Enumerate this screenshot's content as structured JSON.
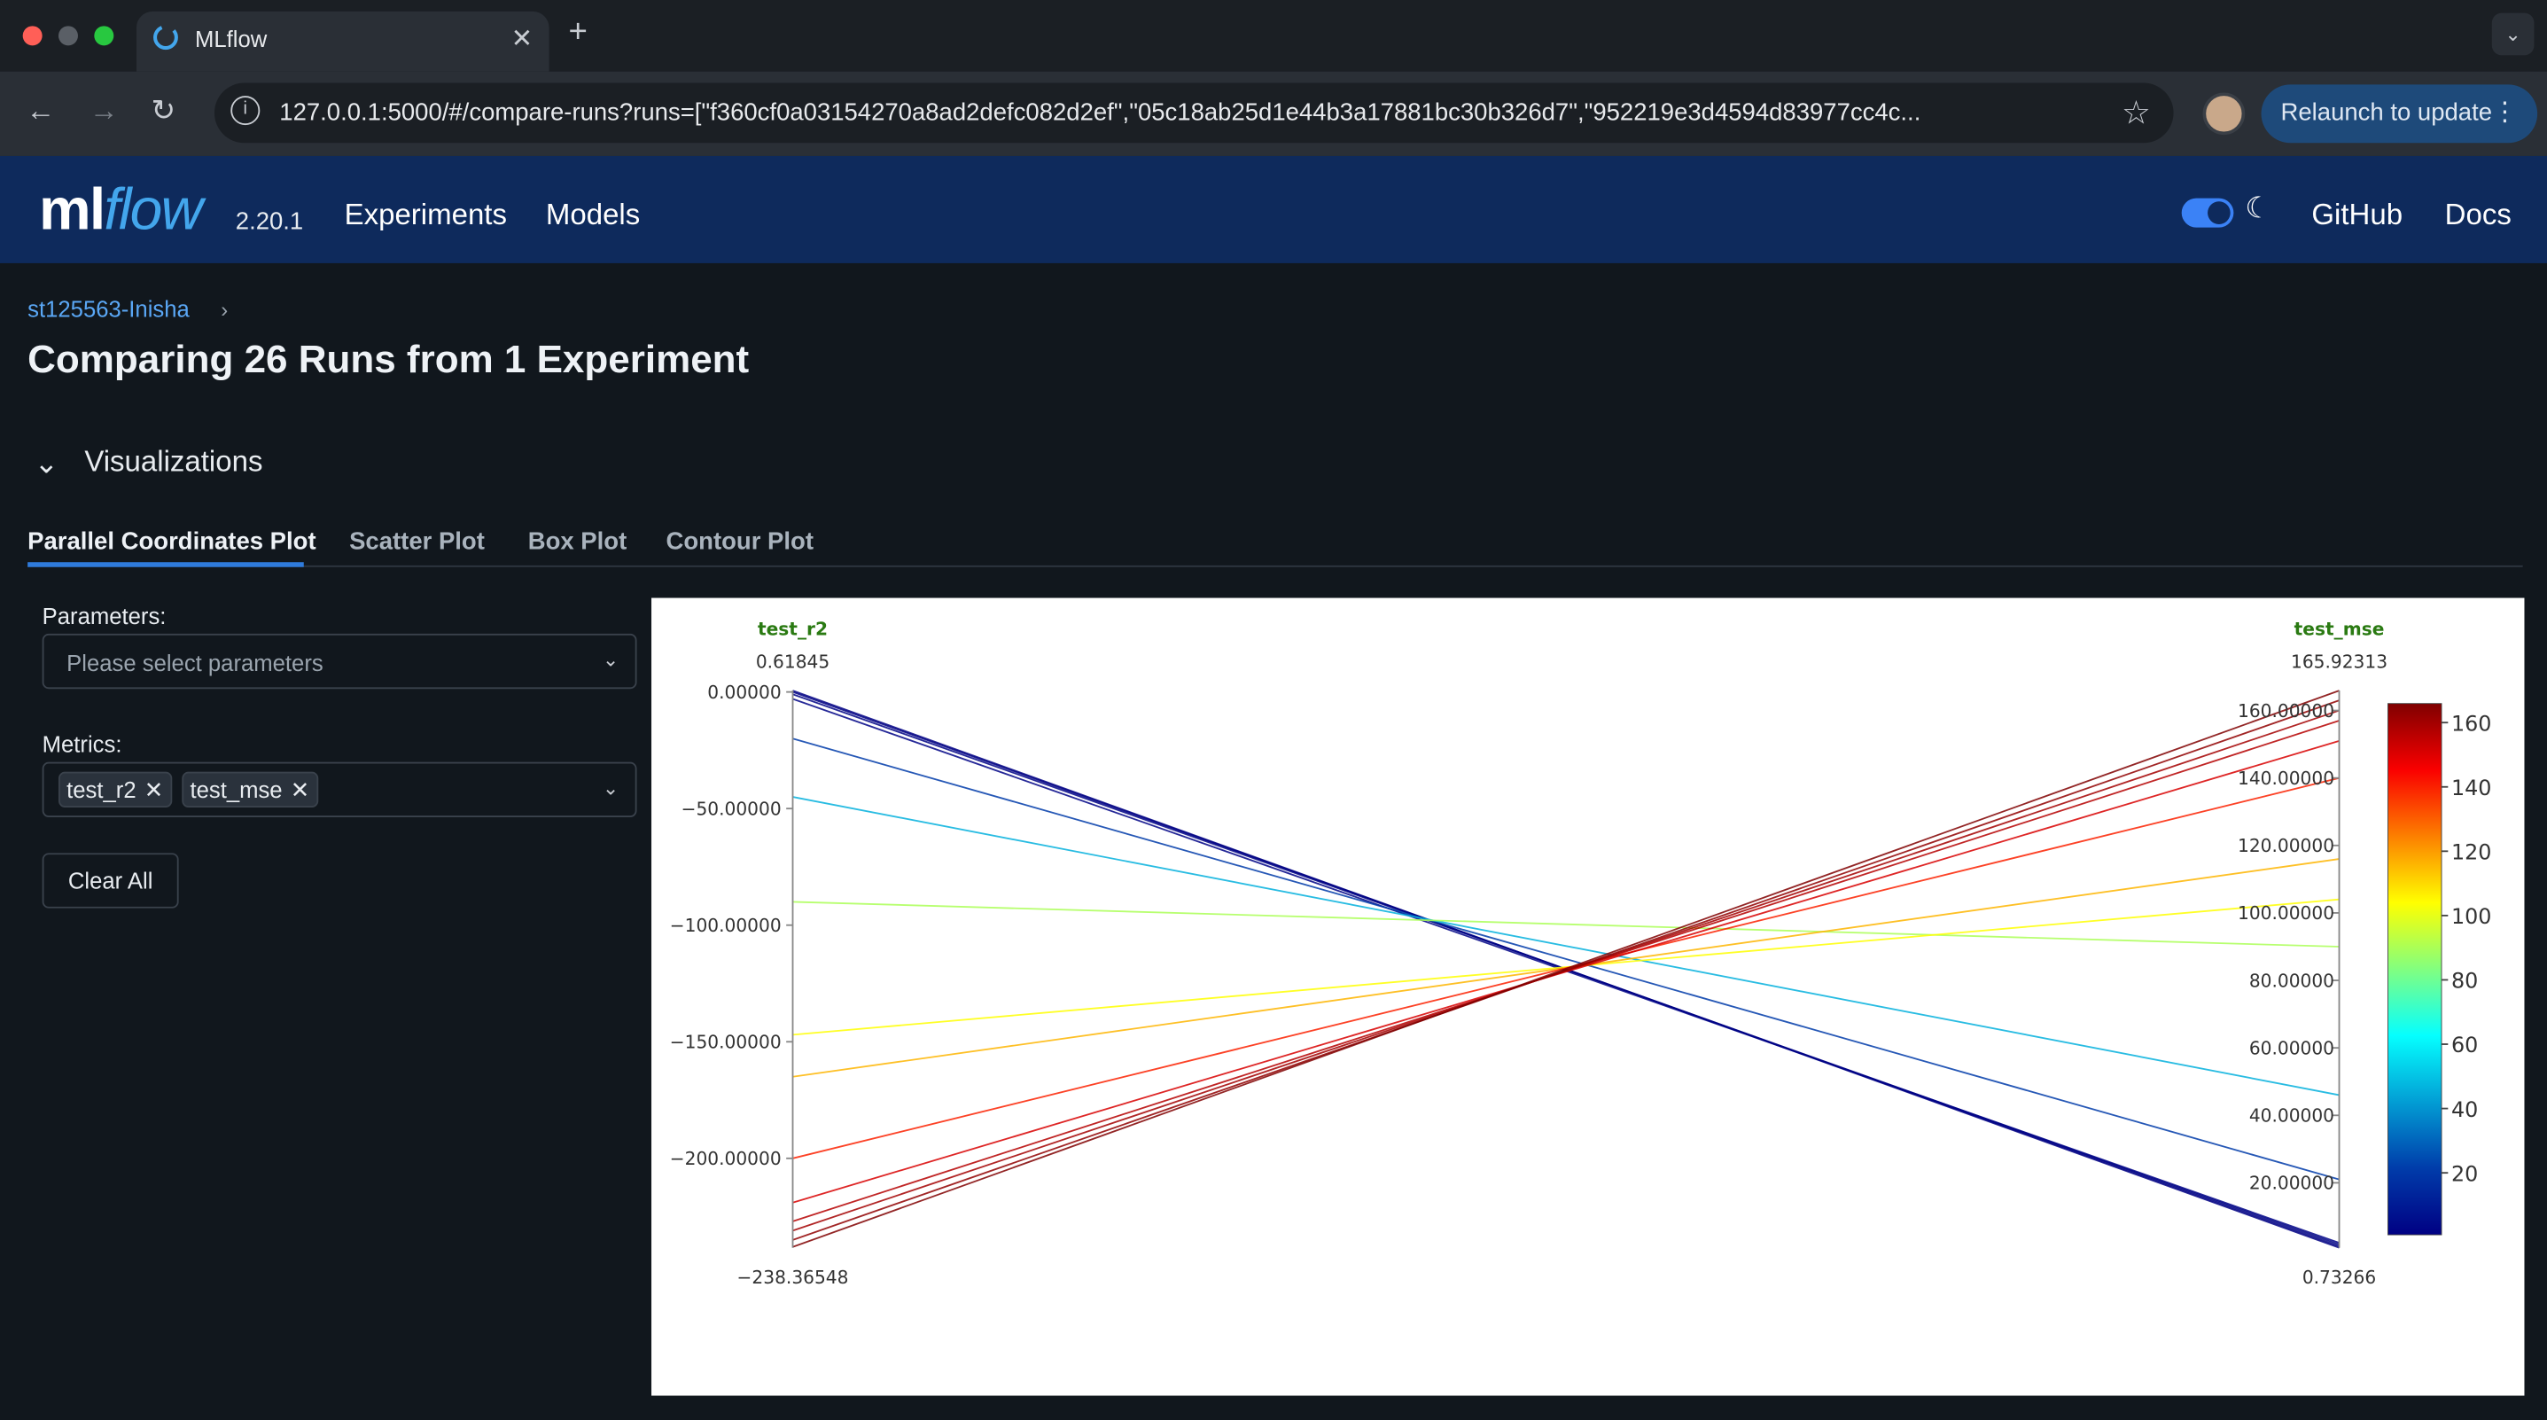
{
  "browser": {
    "tab_title": "MLflow",
    "url": "127.0.0.1:5000/#/compare-runs?runs=[\"f360cf0a03154270a8ad2defc082d2ef\",\"05c18ab25d1e44b3a17881bc30b326d7\",\"952219e3d4594d83977cc4c...",
    "relaunch_label": "Relaunch to update"
  },
  "header": {
    "logo_ml": "ml",
    "logo_flow": "flow",
    "version": "2.20.1",
    "nav": [
      "Experiments",
      "Models"
    ],
    "github": "GitHub",
    "docs": "Docs"
  },
  "breadcrumb": "st125563-Inisha",
  "page_title": "Comparing 26 Runs from 1 Experiment",
  "section_title": "Visualizations",
  "tabs": [
    "Parallel Coordinates Plot",
    "Scatter Plot",
    "Box Plot",
    "Contour Plot"
  ],
  "controls": {
    "parameters_label": "Parameters:",
    "parameters_placeholder": "Please select parameters",
    "metrics_label": "Metrics:",
    "metrics_selected": [
      "test_r2",
      "test_mse"
    ],
    "clear_all": "Clear All"
  },
  "chart_data": {
    "type": "parallel_coordinates",
    "axes": [
      {
        "name": "test_r2",
        "range_max_label": "0.61845",
        "range_min_label": "−238.36548",
        "range": [
          -238.36548,
          0.61845
        ],
        "ticks": [
          "0.00000",
          "−50.00000",
          "−100.00000",
          "−150.00000",
          "−200.00000"
        ],
        "tick_values": [
          0,
          -50,
          -100,
          -150,
          -200
        ]
      },
      {
        "name": "test_mse",
        "range_max_label": "165.92313",
        "range_min_label": "0.73266",
        "range": [
          0.73266,
          165.92313
        ],
        "ticks": [
          "160.00000",
          "140.00000",
          "120.00000",
          "100.00000",
          "80.00000",
          "60.00000",
          "40.00000",
          "20.00000"
        ],
        "tick_values": [
          160,
          140,
          120,
          100,
          80,
          60,
          40,
          20
        ]
      }
    ],
    "colorscale": {
      "metric": "test_mse",
      "ticks": [
        "160",
        "140",
        "120",
        "100",
        "80",
        "60",
        "40",
        "20"
      ],
      "tick_values": [
        160,
        140,
        120,
        100,
        80,
        60,
        40,
        20
      ]
    },
    "lines": [
      {
        "test_r2": 0.6,
        "test_mse": 0.75
      },
      {
        "test_r2": 0.0,
        "test_mse": 1.2
      },
      {
        "test_r2": -1.0,
        "test_mse": 1.7
      },
      {
        "test_r2": -3.0,
        "test_mse": 2.2
      },
      {
        "test_r2": -20.0,
        "test_mse": 21.0
      },
      {
        "test_r2": -45.0,
        "test_mse": 46.0
      },
      {
        "test_r2": -90.0,
        "test_mse": 90.0
      },
      {
        "test_r2": -147.0,
        "test_mse": 104.0
      },
      {
        "test_r2": -165.0,
        "test_mse": 116.0
      },
      {
        "test_r2": -200.0,
        "test_mse": 140.0
      },
      {
        "test_r2": -219.0,
        "test_mse": 151.0
      },
      {
        "test_r2": -227.0,
        "test_mse": 157.0
      },
      {
        "test_r2": -231.0,
        "test_mse": 160.0
      },
      {
        "test_r2": -235.0,
        "test_mse": 163.0
      },
      {
        "test_r2": -238.0,
        "test_mse": 165.9
      }
    ]
  },
  "colors": {
    "header_bg": "#0e2a5c",
    "page_bg": "#11171d",
    "accent": "#2f7bdc",
    "axis_title": "#2a7a12"
  }
}
